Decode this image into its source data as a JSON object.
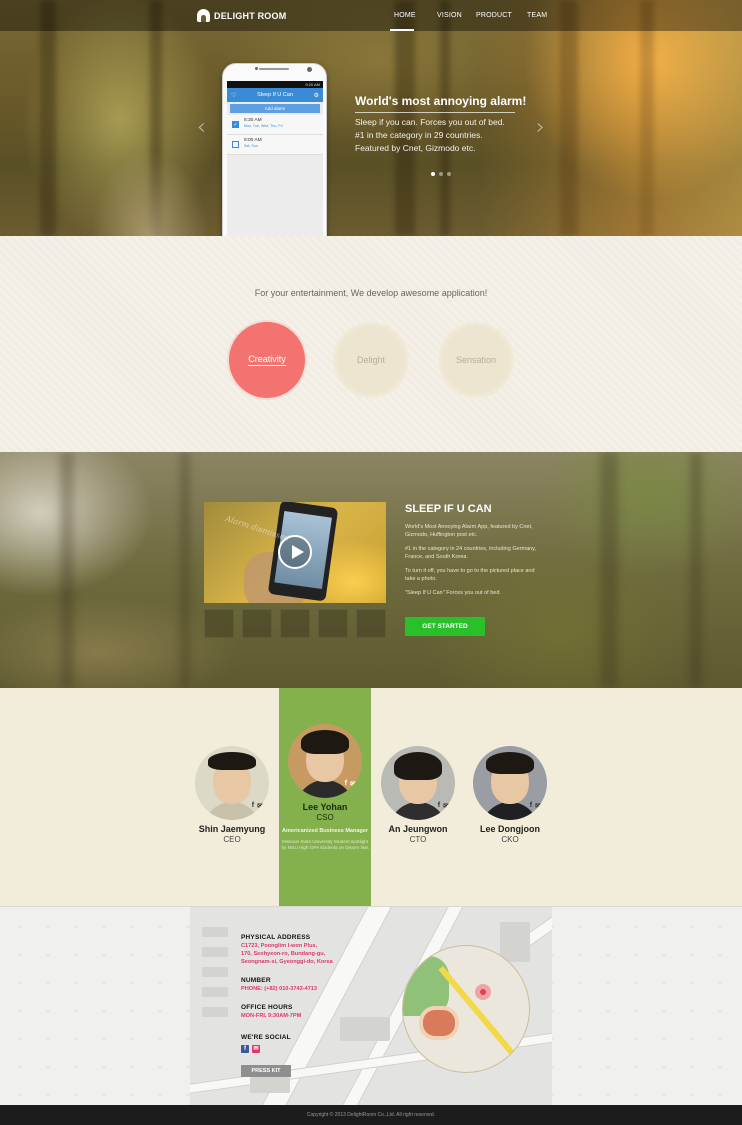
{
  "brand": {
    "name": "DELIGHT ROOM"
  },
  "nav": {
    "items": [
      "HOME",
      "VISION",
      "PRODUCT",
      "TEAM"
    ],
    "active": "HOME"
  },
  "hero": {
    "title": "World's most annoying alarm!",
    "lines": [
      "Sleep if you can. Forces you out of bed.",
      "#1 in the category in 29 countries.",
      "Featured by Cnet, Gizmodo etc."
    ],
    "prev_icon": "chevron-left-icon",
    "next_icon": "chevron-right-icon",
    "active_slide": 1,
    "slide_count": 3
  },
  "phone": {
    "status_time": "9:20 AM",
    "app_title": "Sleep If U Can",
    "add_alarm": "Add alarm",
    "alarms": [
      {
        "time": "8:30 AM",
        "days": "Mon, Tue, Wed, Thu, Fri",
        "enabled": true
      },
      {
        "time": "9:00 AM",
        "days": "Sat, Sun",
        "enabled": false
      }
    ]
  },
  "intro": {
    "tagline": "For your entertainment, We develop awesome application!",
    "circles": [
      {
        "label": "Creativity",
        "active": true
      },
      {
        "label": "Delight",
        "active": false
      },
      {
        "label": "Sensation",
        "active": false
      }
    ],
    "active_color": "#f27370"
  },
  "product": {
    "title": "SLEEP IF U CAN",
    "paragraphs": [
      "World's Most Annoying Alarm App, featured by Cnet, Gizmodo, Huffington post etc.",
      "#1 in the category in 24 countries, including Germany, France, and South Korea.",
      "To turn it off, you have to go to the pictured place and take a photo.",
      "\"Sleep If U Can\" Forces you out of bed."
    ],
    "cta": "GET STARTED",
    "cta_color": "#2ac02a",
    "video_overlay_text": "Alarm dismissed",
    "thumbnail_count": 5
  },
  "team": {
    "highlight_color": "#84b14e",
    "members": [
      {
        "name": "Shin Jaemyung",
        "role": "CEO"
      },
      {
        "name": "Lee Yohan",
        "role": "CSO",
        "extra_title": "Americanized Business Manager",
        "extra": "Missouri State University Student spotlight by MSU High GPA students on Dean's lists"
      },
      {
        "name": "An Jeungwon",
        "role": "CTO"
      },
      {
        "name": "Lee Dongjoon",
        "role": "CKO"
      }
    ]
  },
  "contact": {
    "address_label": "PHYSICAL ADDRESS",
    "address_lines": [
      "C1723, Poonglim I-won Plus,",
      "170, Seohyeon-ro, Bundang-gu,",
      "Seongnam-si, Gyeonggi-do, Korea"
    ],
    "number_label": "NUMBER",
    "phone": "PHONE: (+82) 010-3743-4713",
    "hours_label": "OFFICE HOURS",
    "hours": "MON-FRI, 9:30AM-7PM",
    "social_label": "WE'RE SOCIAL",
    "press_kit": "PRESS KIT",
    "accent_color": "#e6336b"
  },
  "footer": {
    "copyright": "Copyright © 2013 DelightRoom Co.,Ltd. All right reserved."
  }
}
